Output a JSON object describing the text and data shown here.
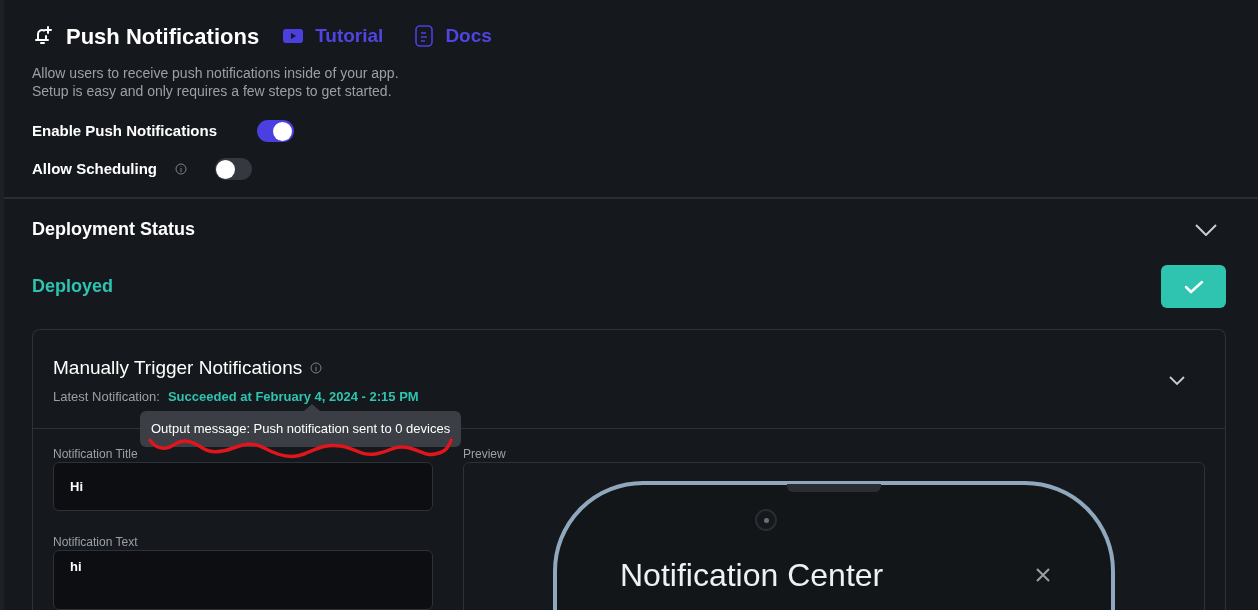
{
  "header": {
    "title": "Push Notifications",
    "links": [
      {
        "kind": "video",
        "label": "Tutorial"
      },
      {
        "kind": "doc",
        "label": "Docs"
      }
    ],
    "description": [
      "Allow users to receive push notifications inside of your app.",
      "Setup is easy and only requires a few steps to get started."
    ]
  },
  "settings": [
    {
      "label": "Enable Push Notifications",
      "info": false,
      "on": true
    },
    {
      "label": "Allow Scheduling",
      "info": true,
      "on": false
    }
  ],
  "deployment": {
    "title": "Deployment Status",
    "status": "Deployed"
  },
  "manual_trigger": {
    "title": "Manually Trigger Notifications",
    "latest_label": "Latest Notification:",
    "latest_value": "Succeeded at February 4, 2024 - 2:15 PM",
    "tooltip": "Output message: Push notification sent to 0 devices",
    "fields": [
      {
        "kind": "input",
        "label": "Notification Title",
        "value": "Hi"
      },
      {
        "kind": "textarea",
        "label": "Notification Text",
        "value": "hi"
      }
    ],
    "preview": {
      "label": "Preview",
      "screen_title": "Notification Center"
    }
  }
}
